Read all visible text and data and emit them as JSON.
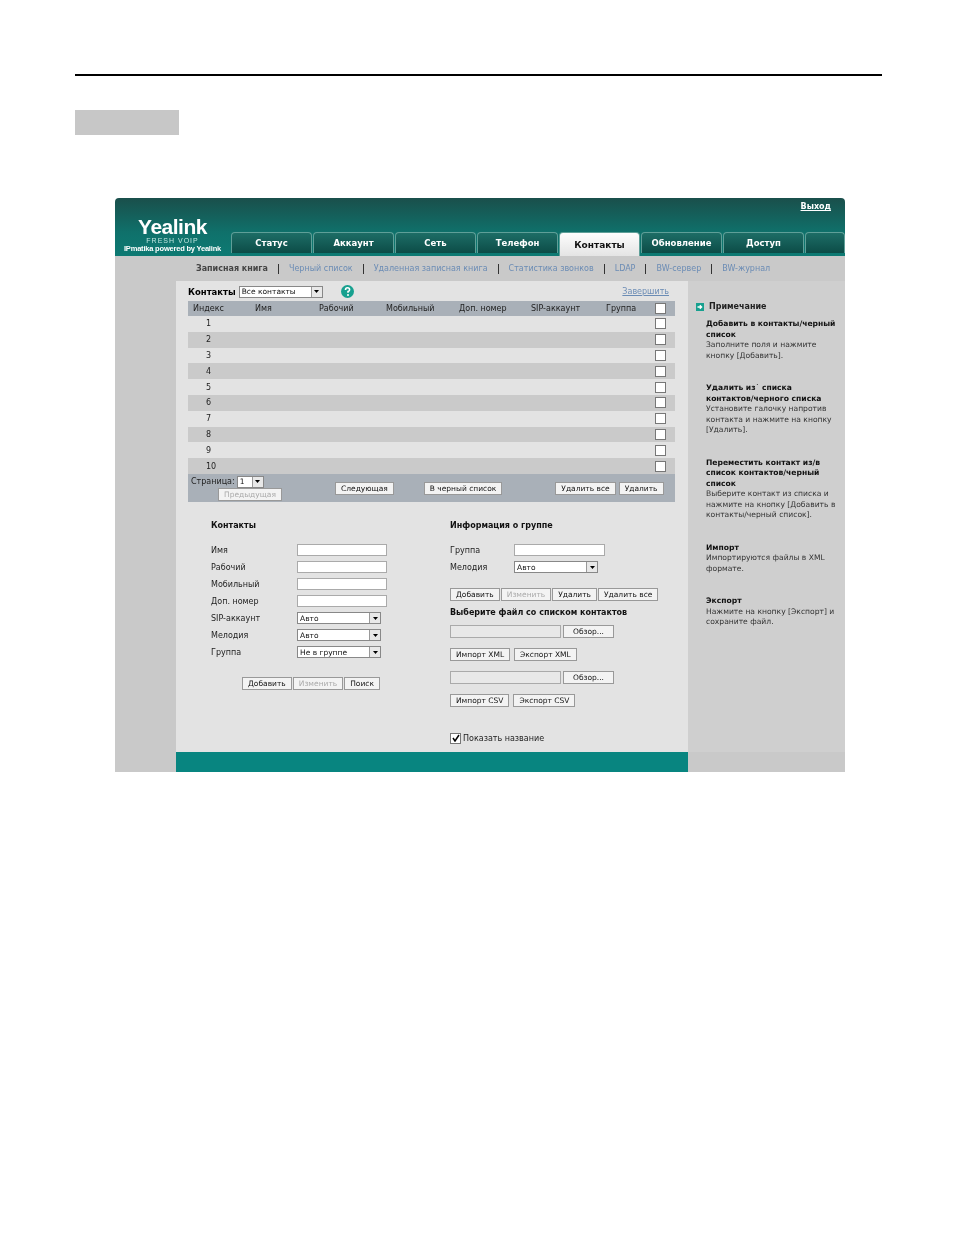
{
  "logo": {
    "name": "Yealink",
    "tagline": "FRESH VOIP",
    "caption": "IPmatika powered by Yealink"
  },
  "logout": "Выход",
  "tabs": [
    {
      "label": "Статус",
      "selected": false
    },
    {
      "label": "Аккаунт",
      "selected": false
    },
    {
      "label": "Сеть",
      "selected": false
    },
    {
      "label": "Телефон",
      "selected": false
    },
    {
      "label": "Контакты",
      "selected": true
    },
    {
      "label": "Обновление",
      "selected": false
    },
    {
      "label": "Доступ",
      "selected": false
    }
  ],
  "subnav": [
    {
      "label": "Записная книга",
      "selected": true
    },
    {
      "label": "Черный список",
      "selected": false
    },
    {
      "label": "Удаленная записная книга",
      "selected": false
    },
    {
      "label": "Статистика звонков",
      "selected": false
    },
    {
      "label": "LDAP",
      "selected": false
    },
    {
      "label": "BW-сервер",
      "selected": false
    },
    {
      "label": "BW-журнал",
      "selected": false
    }
  ],
  "contacts_table": {
    "title": "Контакты",
    "filter": "Все контакты",
    "finish_link": "Завершить",
    "columns": [
      "Индекс",
      "Имя",
      "Рабочий",
      "Мобильный",
      "Доп. номер",
      "SIP-аккаунт",
      "Группа"
    ],
    "header_checked": false,
    "rows": [
      {
        "index": "1",
        "checked": false
      },
      {
        "index": "2",
        "checked": false
      },
      {
        "index": "3",
        "checked": false
      },
      {
        "index": "4",
        "checked": false
      },
      {
        "index": "5",
        "checked": false
      },
      {
        "index": "6",
        "checked": false
      },
      {
        "index": "7",
        "checked": false
      },
      {
        "index": "8",
        "checked": false
      },
      {
        "index": "9",
        "checked": false
      },
      {
        "index": "10",
        "checked": false
      }
    ],
    "page_label": "Страница:",
    "page": "1",
    "prev_button": {
      "label": "Предыдущая",
      "disabled": true
    },
    "buttons": [
      {
        "label": "Следующая",
        "disabled": false
      },
      {
        "label": "В черный список",
        "disabled": false
      },
      {
        "label": "Удалить все",
        "disabled": false
      },
      {
        "label": "Удалить",
        "disabled": false
      }
    ]
  },
  "contact_form": {
    "title": "Контакты",
    "fields": [
      {
        "label": "Имя",
        "kind": "text"
      },
      {
        "label": "Рабочий",
        "kind": "text"
      },
      {
        "label": "Мобильный",
        "kind": "text"
      },
      {
        "label": "Доп. номер",
        "kind": "text"
      },
      {
        "label": "SIP-аккаунт",
        "kind": "select",
        "value": "Авто"
      },
      {
        "label": "Мелодия",
        "kind": "select",
        "value": "Авто"
      },
      {
        "label": "Группа",
        "kind": "select",
        "value": "Не в группе"
      }
    ],
    "buttons": [
      {
        "label": "Добавить",
        "disabled": false
      },
      {
        "label": "Изменить",
        "disabled": true
      },
      {
        "label": "Поиск",
        "disabled": false
      }
    ]
  },
  "group_info": {
    "title": "Информация о группе",
    "fields": [
      {
        "label": "Группа",
        "kind": "text"
      },
      {
        "label": "Мелодия",
        "kind": "select",
        "value": "Авто"
      }
    ],
    "buttons": [
      {
        "label": "Добавить",
        "disabled": false
      },
      {
        "label": "Изменить",
        "disabled": true
      },
      {
        "label": "Удалить",
        "disabled": false
      },
      {
        "label": "Удалить все",
        "disabled": false
      }
    ]
  },
  "file_import": {
    "title": "Выберите файл со списком контактов",
    "files": [
      {
        "browse": "Обзор...",
        "buttons": [
          "Импорт XML",
          "Экспорт XML"
        ]
      },
      {
        "browse": "Обзор...",
        "buttons": [
          "Импорт CSV",
          "Экспорт CSV"
        ]
      }
    ],
    "show_name": {
      "label": "Показать название",
      "checked": true
    }
  },
  "note": {
    "title": "Примечание",
    "sections": [
      {
        "heading": "Добавить в контакты/черный список",
        "text": "Заполните поля и нажмите кнопку [Добавить]."
      },
      {
        "heading": "Удалить из˙ списка контактов/черного списка",
        "text": "Установите галочку напротив контакта и нажмите на кнопку [Удалить]."
      },
      {
        "heading": "Переместить контакт из/в список контактов/черный список",
        "text": "Выберите контакт из списка и нажмите на кнопку [Добавить в контакты/черный список]."
      },
      {
        "heading": "Импорт",
        "text": "Импортируются файлы в XML формате."
      },
      {
        "heading": "Экспорт",
        "text": "Нажмите на кнопку [Экспорт] и сохраните файл."
      }
    ]
  }
}
